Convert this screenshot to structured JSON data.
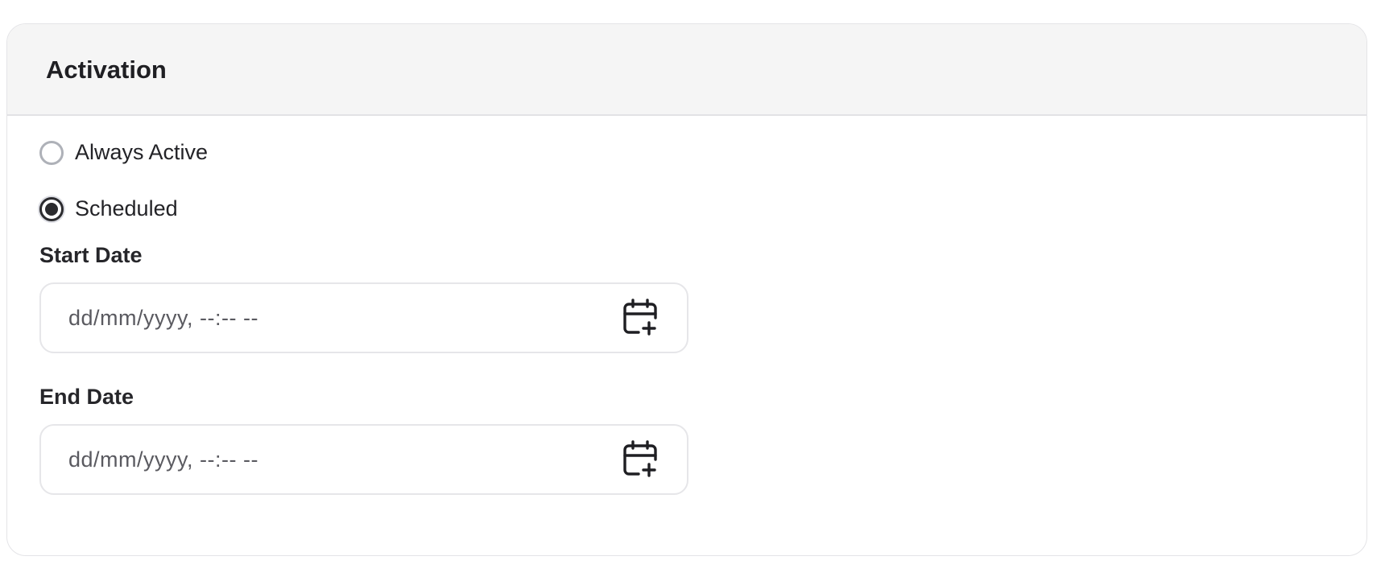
{
  "card": {
    "title": "Activation"
  },
  "activation": {
    "options": [
      {
        "label": "Always Active",
        "checked": false
      },
      {
        "label": "Scheduled",
        "checked": true
      }
    ]
  },
  "start_date": {
    "label": "Start Date",
    "placeholder": "dd/mm/yyyy, --:-- --",
    "icon": "calendar-plus-icon"
  },
  "end_date": {
    "label": "End Date",
    "placeholder": "dd/mm/yyyy, --:-- --",
    "icon": "calendar-plus-icon"
  },
  "colors": {
    "header_bg": "#f5f5f5",
    "text": "#1f1f23",
    "border": "#e4e4e7",
    "radio_checked": "#2b2b2e"
  }
}
